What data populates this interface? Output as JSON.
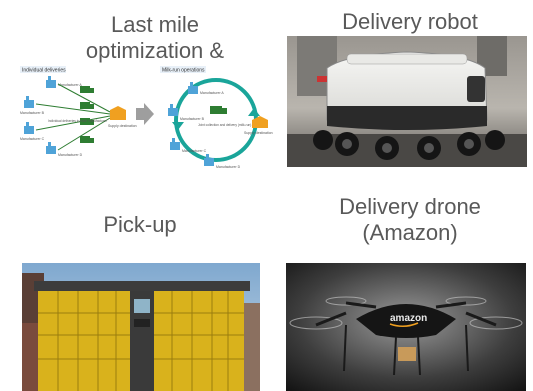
{
  "tiles": {
    "last_mile": {
      "caption_line1": "Last mile",
      "caption_line2": "optimization &",
      "diagram": {
        "left_title": "Individual deliveries",
        "right_title": "Milk-run operations",
        "manufacturers": [
          "Manufacturer A",
          "Manufacturer B",
          "Manufacturer C",
          "Manufacturer D"
        ],
        "supply_destination": "Supply destination",
        "left_note": "Individual deliveries to each manufacturer",
        "right_note": "Joint collection and delivery (milk-run)"
      }
    },
    "robot": {
      "caption": "Delivery robot"
    },
    "pickup": {
      "caption": "Pick-up"
    },
    "drone": {
      "caption_line1": "Delivery drone",
      "caption_line2": "(Amazon)",
      "drone_brand": "amazon"
    }
  },
  "colors": {
    "caption": "#595959",
    "truck_green": "#2e7d32",
    "milkrun_teal": "#1aa59a",
    "factory_blue": "#4fa3d8",
    "destination_orange": "#f0a020",
    "arrow_gray": "#9e9e9e",
    "locker_yellow": "#d9b21c"
  }
}
